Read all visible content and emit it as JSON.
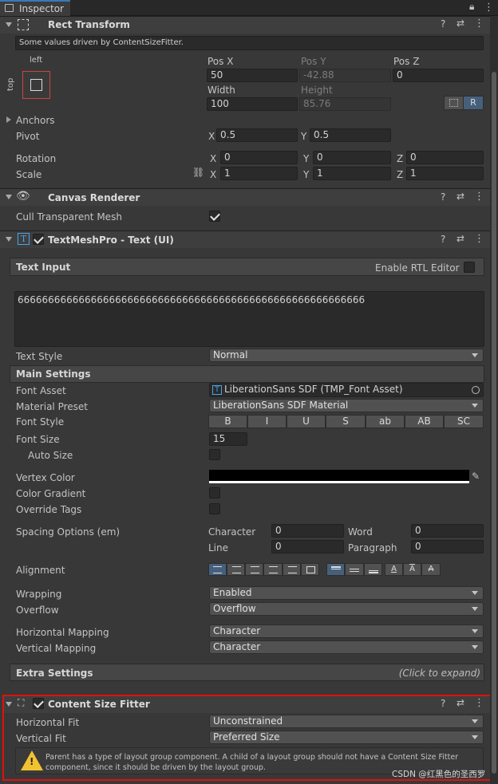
{
  "window": {
    "tab_title": "Inspector"
  },
  "rect_transform": {
    "title": "Rect Transform",
    "note": "Some values driven by ContentSizeFitter.",
    "anchor_preset": {
      "h": "left",
      "v": "top"
    },
    "pos_x_label": "Pos X",
    "pos_y_label": "Pos Y",
    "pos_z_label": "Pos Z",
    "pos_x": "50",
    "pos_y": "-42.88",
    "pos_z": "0",
    "width_label": "Width",
    "height_label": "Height",
    "width": "100",
    "height": "85.76",
    "raw_button": "R",
    "anchors_label": "Anchors",
    "pivot_label": "Pivot",
    "pivot_x": "0.5",
    "pivot_y": "0.5",
    "rotation_label": "Rotation",
    "rot_x": "0",
    "rot_y": "0",
    "rot_z": "0",
    "scale_label": "Scale",
    "scale_x": "1",
    "scale_y": "1",
    "scale_z": "1",
    "axis_x": "X",
    "axis_y": "Y",
    "axis_z": "Z"
  },
  "canvas_renderer": {
    "title": "Canvas Renderer",
    "cull_label": "Cull Transparent Mesh",
    "cull_checked": true
  },
  "tmp": {
    "title": "TextMeshPro - Text (UI)",
    "enabled": true,
    "text_input_header": "Text Input",
    "rtl_label": "Enable RTL Editor",
    "text_value": "666666666666666666666666666666666666666666666666666666666",
    "text_style_label": "Text Style",
    "text_style_value": "Normal",
    "main_settings_header": "Main Settings",
    "font_asset_label": "Font Asset",
    "font_asset_value": "LiberationSans SDF (TMP_Font Asset)",
    "material_preset_label": "Material Preset",
    "material_preset_value": "LiberationSans SDF Material",
    "font_style_label": "Font Style",
    "font_style_buttons": [
      "B",
      "I",
      "U",
      "S",
      "ab",
      "AB",
      "SC"
    ],
    "font_size_label": "Font Size",
    "font_size_value": "15",
    "auto_size_label": "Auto Size",
    "vertex_color_label": "Vertex Color",
    "vertex_color": "#000000",
    "color_gradient_label": "Color Gradient",
    "override_tags_label": "Override Tags",
    "spacing_label": "Spacing Options (em)",
    "character_label": "Character",
    "character_value": "0",
    "word_label": "Word",
    "word_value": "0",
    "line_label": "Line",
    "line_value": "0",
    "paragraph_label": "Paragraph",
    "paragraph_value": "0",
    "alignment_label": "Alignment",
    "wrapping_label": "Wrapping",
    "wrapping_value": "Enabled",
    "overflow_label": "Overflow",
    "overflow_value": "Overflow",
    "hmap_label": "Horizontal Mapping",
    "hmap_value": "Character",
    "vmap_label": "Vertical Mapping",
    "vmap_value": "Character",
    "extra_header": "Extra Settings",
    "extra_hint": "(Click to expand)"
  },
  "csf": {
    "title": "Content Size Fitter",
    "enabled": true,
    "hfit_label": "Horizontal Fit",
    "hfit_value": "Unconstrained",
    "vfit_label": "Vertical Fit",
    "vfit_value": "Preferred Size",
    "warning_line1": "Parent has a type of layout group component. A child of a layout group should not have a Content Size Fitter",
    "warning_line2": "component, since it should be driven by the layout group.",
    "highlight_color": "#e01010"
  },
  "watermark": "CSDN @红黑色的圣西罗"
}
